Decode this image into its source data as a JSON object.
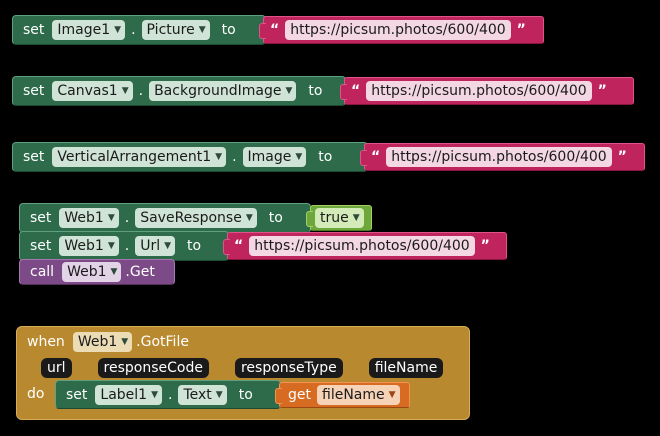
{
  "keywords": {
    "set": "set",
    "to": "to",
    "call": "call",
    "when": "when",
    "do": "do",
    "get": "get",
    "dot": ".",
    "quote_open": "“",
    "quote_close": "”"
  },
  "blocks": {
    "b1": {
      "component": "Image1",
      "property": "Picture",
      "value": "https://picsum.photos/600/400"
    },
    "b2": {
      "component": "Canvas1",
      "property": "BackgroundImage",
      "value": "https://picsum.photos/600/400"
    },
    "b3": {
      "component": "VerticalArrangement1",
      "property": "Image",
      "value": "https://picsum.photos/600/400"
    },
    "b4": {
      "component": "Web1",
      "property": "SaveResponse",
      "value": "true"
    },
    "b5": {
      "component": "Web1",
      "property": "Url",
      "value": "https://picsum.photos/600/400"
    },
    "b6": {
      "component": "Web1",
      "method": ".Get"
    },
    "event": {
      "component": "Web1",
      "event": ".GotFile",
      "params": [
        "url",
        "responseCode",
        "responseType",
        "fileName"
      ],
      "inner": {
        "component": "Label1",
        "property": "Text",
        "get_var": "fileName"
      }
    }
  },
  "colors": {
    "background": "#000000",
    "set_block": "#2d6b4a",
    "text_block": "#c0245d",
    "logic_block": "#6fa83a",
    "call_block": "#7c4a86",
    "event_block": "#b8892e",
    "get_block": "#d86b22"
  }
}
